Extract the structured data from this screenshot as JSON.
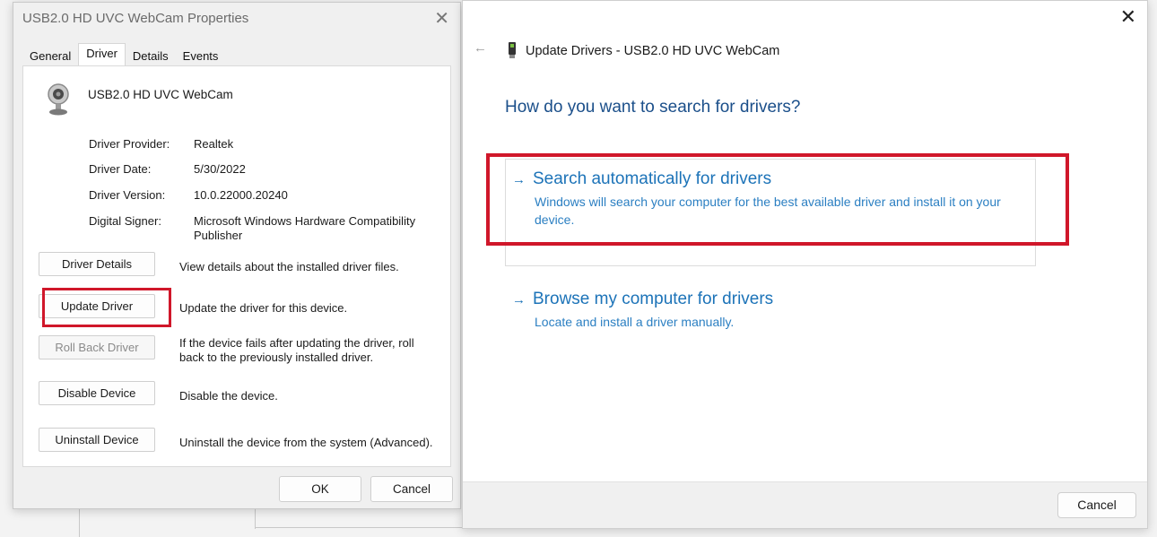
{
  "properties_dialog": {
    "title": "USB2.0 HD UVC WebCam Properties",
    "close_glyph": "✕",
    "tabs": [
      "General",
      "Driver",
      "Details",
      "Events"
    ],
    "active_tab": "Driver",
    "device_name": "USB2.0 HD UVC WebCam",
    "info": [
      {
        "label": "Driver Provider:",
        "value": "Realtek"
      },
      {
        "label": "Driver Date:",
        "value": "5/30/2022"
      },
      {
        "label": "Driver Version:",
        "value": "10.0.22000.20240"
      },
      {
        "label": "Digital Signer:",
        "value": "Microsoft Windows Hardware Compatibility Publisher"
      }
    ],
    "actions": [
      {
        "label": "Driver Details",
        "desc": "View details about the installed driver files."
      },
      {
        "label": "Update Driver",
        "desc": "Update the driver for this device."
      },
      {
        "label": "Roll Back Driver",
        "desc": "If the device fails after updating the driver, roll back to the previously installed driver."
      },
      {
        "label": "Disable Device",
        "desc": "Disable the device."
      },
      {
        "label": "Uninstall Device",
        "desc": "Uninstall the device from the system (Advanced)."
      }
    ],
    "ok_label": "OK",
    "cancel_label": "Cancel"
  },
  "update_window": {
    "close_glyph": "✕",
    "back_glyph": "←",
    "title": "Update Drivers - USB2.0 HD UVC WebCam",
    "heading": "How do you want to search for drivers?",
    "options": [
      {
        "arrow": "→",
        "title": "Search automatically for drivers",
        "desc": "Windows will search your computer for the best available driver and install it on your device."
      },
      {
        "arrow": "→",
        "title": "Browse my computer for drivers",
        "desc": "Locate and install a driver manually."
      }
    ],
    "cancel_label": "Cancel"
  },
  "colors": {
    "highlight_red": "#d0172a",
    "link_blue": "#1c73b8",
    "heading_blue": "#1b4f8a"
  }
}
